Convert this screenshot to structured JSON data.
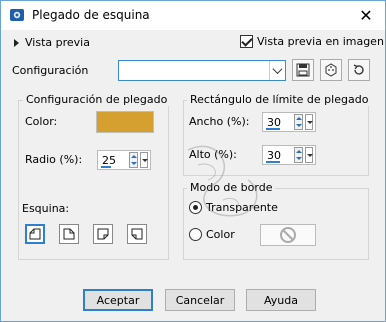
{
  "window": {
    "title": "Plegado de esquina"
  },
  "preview": {
    "label": "Vista previa",
    "image_checkbox_label": "Vista previa en imagen",
    "image_checked": true
  },
  "config": {
    "label": "Configuración",
    "value": ""
  },
  "fold": {
    "group_title": "Configuración de plegado",
    "color_label": "Color:",
    "color_value": "#d6a031",
    "radius_label": "Radio (%):",
    "radius_value": "25",
    "corner_label": "Esquina:",
    "corners": [
      "top-left",
      "top-right",
      "bottom-right",
      "bottom-left"
    ],
    "selected_corner": "top-left"
  },
  "rect": {
    "group_title": "Rectángulo de límite de plegado",
    "width_label": "Ancho (%):",
    "width_value": "30",
    "height_label": "Alto (%):",
    "height_value": "30"
  },
  "border": {
    "group_title": "Modo de borde",
    "transparent_label": "Transparente",
    "color_label": "Color",
    "selected": "transparent"
  },
  "buttons": {
    "ok": "Aceptar",
    "cancel": "Cancelar",
    "help": "Ayuda"
  },
  "accent": "#2f7fd0"
}
